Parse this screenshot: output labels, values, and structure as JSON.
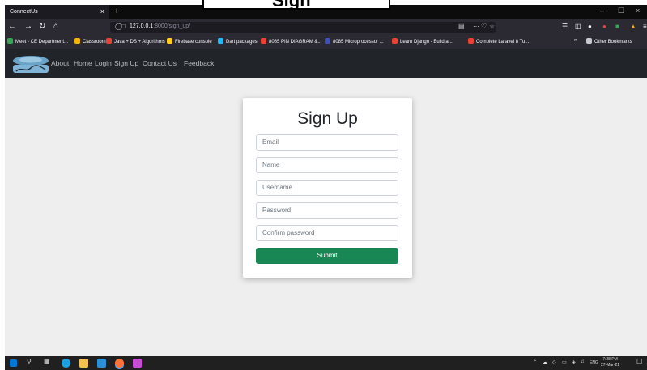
{
  "overlay": {
    "text": "Sign"
  },
  "browser": {
    "tab_title": "ConnectUs",
    "tab_close": "×",
    "new_tab": "+",
    "url_host": "127.0.0.1",
    "url_path": ":8000/sign_up/",
    "window_minimize": "–",
    "window_maximize": "☐",
    "window_close": "×",
    "bookmarks": [
      {
        "label": "Meet - CE Department...",
        "color": "#34a853"
      },
      {
        "label": "Classroom",
        "color": "#f4b400"
      },
      {
        "label": "Java + DS + Algorithms",
        "color": "#ea4335"
      },
      {
        "label": "Firebase console",
        "color": "#ffca28"
      },
      {
        "label": "Dart packages",
        "color": "#29b6f6"
      },
      {
        "label": "8085 PIN DIAGRAM &...",
        "color": "#ea4335"
      },
      {
        "label": "8085 Microprocessor ...",
        "color": "#3f51b5"
      },
      {
        "label": "Learn Django - Build a...",
        "color": "#ea4335"
      },
      {
        "label": "Complete Laravel 8 Tu...",
        "color": "#ea4335"
      }
    ],
    "other_bookmarks": "Other Bookmarks"
  },
  "app_nav": {
    "links": [
      "About",
      "Home",
      "Login",
      "Sign Up",
      "Contact Us",
      "Feedback"
    ]
  },
  "form": {
    "title": "Sign Up",
    "fields": [
      {
        "placeholder": "Email"
      },
      {
        "placeholder": "Name"
      },
      {
        "placeholder": "Username"
      },
      {
        "placeholder": "Password"
      },
      {
        "placeholder": "Confirm password"
      }
    ],
    "submit_label": "Submit",
    "submit_color": "#198754"
  },
  "taskbar": {
    "tray_lang": "ENG",
    "time": "7:28 PM",
    "date": "27-Mar-21"
  }
}
